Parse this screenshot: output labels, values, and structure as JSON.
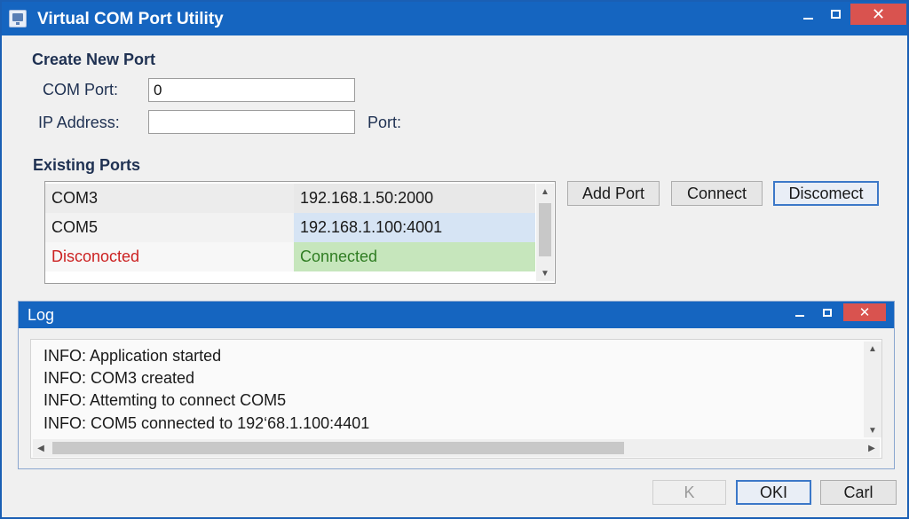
{
  "window": {
    "title": "Virtual COM Port Utility",
    "accent_color": "#1565c0",
    "close_glyph": "✕"
  },
  "create_port": {
    "heading": "Create New Port",
    "com_port_label": "COM  Port:",
    "com_port_value": "0",
    "ip_label": "IP Address:",
    "ip_value": "",
    "port_label": "Port:"
  },
  "existing_ports": {
    "heading": "Existing Ports",
    "rows": [
      {
        "name": "COM3",
        "address": "192.168.1.50:2000"
      },
      {
        "name": "COM5",
        "address": "192.168.1.100:4001"
      },
      {
        "name": "Disconocted",
        "address": "Connected"
      }
    ],
    "status_colors": {
      "disconnected": "#cc2222",
      "connected": "#2f7d22"
    },
    "scroll_up_glyph": "▲",
    "scroll_down_glyph": "▼"
  },
  "actions": {
    "add_port": "Add Port",
    "connect": "Connect",
    "disconnect": "Discomect"
  },
  "log": {
    "title": "Log",
    "close_glyph": "✕",
    "lines": [
      "INFO: Application started",
      "INFO: COM3 created",
      "INFO: Attemting to connect COM5",
      "INFO: COM5 connected to 192‘68.1.100:4401"
    ],
    "scroll_left_glyph": "◀",
    "scroll_right_glyph": "▶",
    "scroll_up_glyph": "▲",
    "scroll_down_glyph": "▼"
  },
  "footer": {
    "back": "K",
    "ok": "OKI",
    "cancel": "Carl"
  }
}
